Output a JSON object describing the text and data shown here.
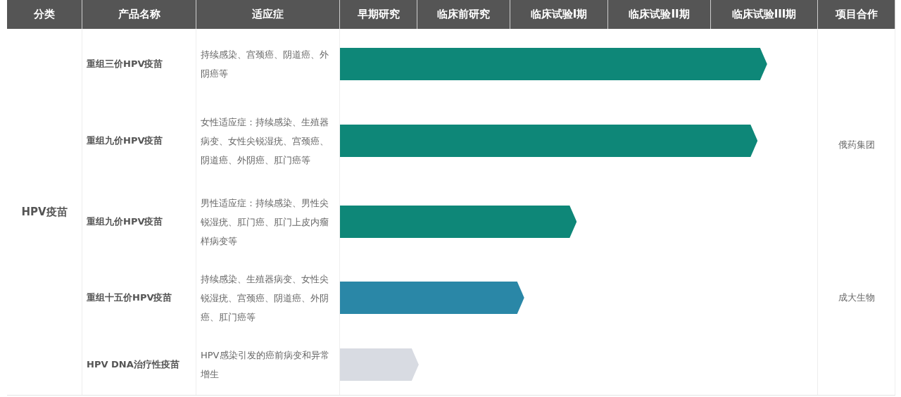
{
  "table": {
    "columns": [
      "分类",
      "产品名称",
      "适应症",
      "早期研究",
      "临床前研究",
      "临床试验I期",
      "临床试验II期",
      "临床试验III期",
      "项目合作"
    ],
    "category": {
      "name": "HPV疫苗",
      "groups": [
        {
          "partner": "俄药集团",
          "products": [
            {
              "name": "重组三价HPV疫苗",
              "indication": "持续感染、宫颈癌、阴道癌、外阴癌等",
              "level": 0.895,
              "color": "#0e8778"
            },
            {
              "name": "重组九价HPV疫苗",
              "indication": "女性适应症：持续感染、生殖器病变、女性尖锐湿疣、宫颈癌、阴道癌、外阴癌、肛门癌等",
              "level": 0.875,
              "color": "#0e8778"
            },
            {
              "name": "重组九价HPV疫苗",
              "indication": "男性适应症：持续感染、男性尖锐湿疣、肛门癌、肛门上皮内瘤样病变等",
              "level": 0.496,
              "color": "#0e8778"
            }
          ]
        },
        {
          "partner": "成大生物",
          "products": [
            {
              "name": "重组十五价HPV疫苗",
              "indication": "持续感染、生殖器病变、女性尖锐湿疣、宫颈癌、阴道癌、外阴癌、肛门癌等",
              "level": 0.386,
              "color": "#2a87a7"
            }
          ]
        },
        {
          "products": [
            {
              "name": "HPV DNA治疗性疫苗",
              "indication": "HPV感染引发的癌前病变和异常增生",
              "level": 0.165,
              "color": "#d8dbe2"
            }
          ]
        }
      ]
    }
  }
}
